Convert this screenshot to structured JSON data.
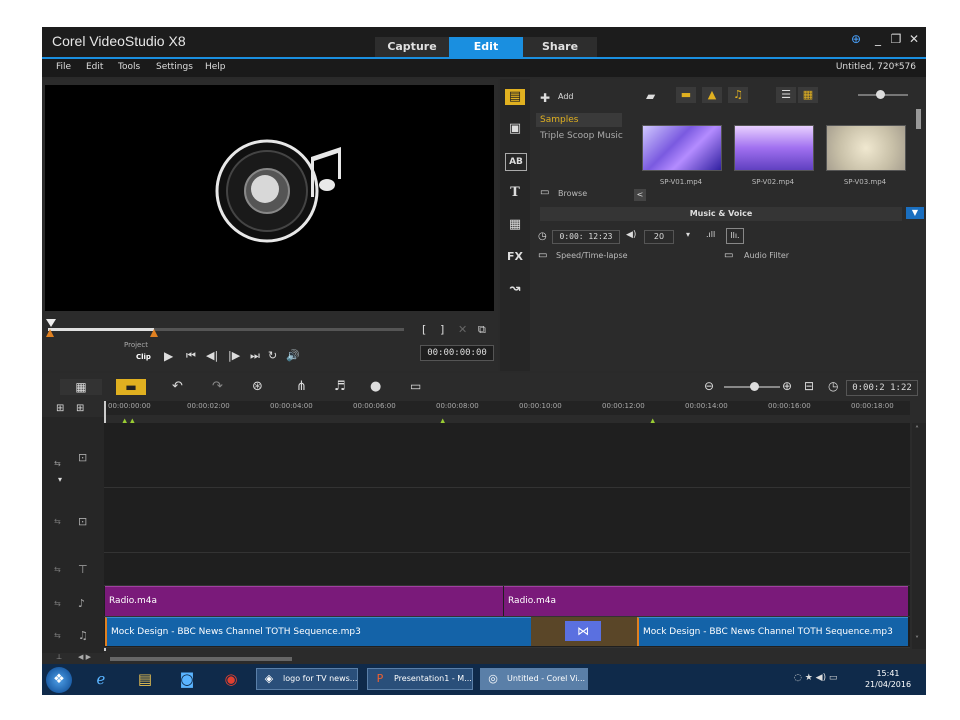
{
  "window": {
    "title": "Corel VideoStudio X8",
    "project_info": "Untitled, 720*576"
  },
  "mode_tabs": [
    {
      "label": "Capture"
    },
    {
      "label": "Edit"
    },
    {
      "label": "Share"
    }
  ],
  "menu": [
    "File",
    "Edit",
    "Tools",
    "Settings",
    "Help"
  ],
  "preview": {
    "project_label": "Project",
    "clip_label": "Clip",
    "timecode": "00:00:00:00"
  },
  "library": {
    "add_label": "Add",
    "folders": [
      "Samples",
      "Triple Scoop Music"
    ],
    "browse_label": "Browse",
    "thumbnails": [
      "SP-V01.mp4",
      "SP-V02.mp4",
      "SP-V03.mp4"
    ],
    "options_header": "Music & Voice",
    "duration": "0:00: 12:23",
    "volume": "20",
    "speed_label": "Speed/Time-lapse",
    "audio_filter_label": "Audio Filter"
  },
  "timeline": {
    "zoom_timecode": "0:00:2 1:22",
    "ruler": [
      "00:00:00:00",
      "00:00:02:00",
      "00:00:04:00",
      "00:00:06:00",
      "00:00:08:00",
      "00:00:10:00",
      "00:00:12:00",
      "00:00:14:00",
      "00:00:16:00",
      "00:00:18:00"
    ],
    "clips": {
      "voice1": "Radio.m4a",
      "voice2": "Radio.m4a",
      "music1": "Mock Design - BBC News Channel TOTH Sequence.mp3",
      "music2": "Mock Design - BBC News Channel TOTH Sequence.mp3"
    }
  },
  "taskbar": {
    "buttons": [
      "logo for TV news...",
      "Presentation1 - M...",
      "Untitled - Corel Vi..."
    ],
    "time": "15:41",
    "date": "21/04/2016"
  }
}
